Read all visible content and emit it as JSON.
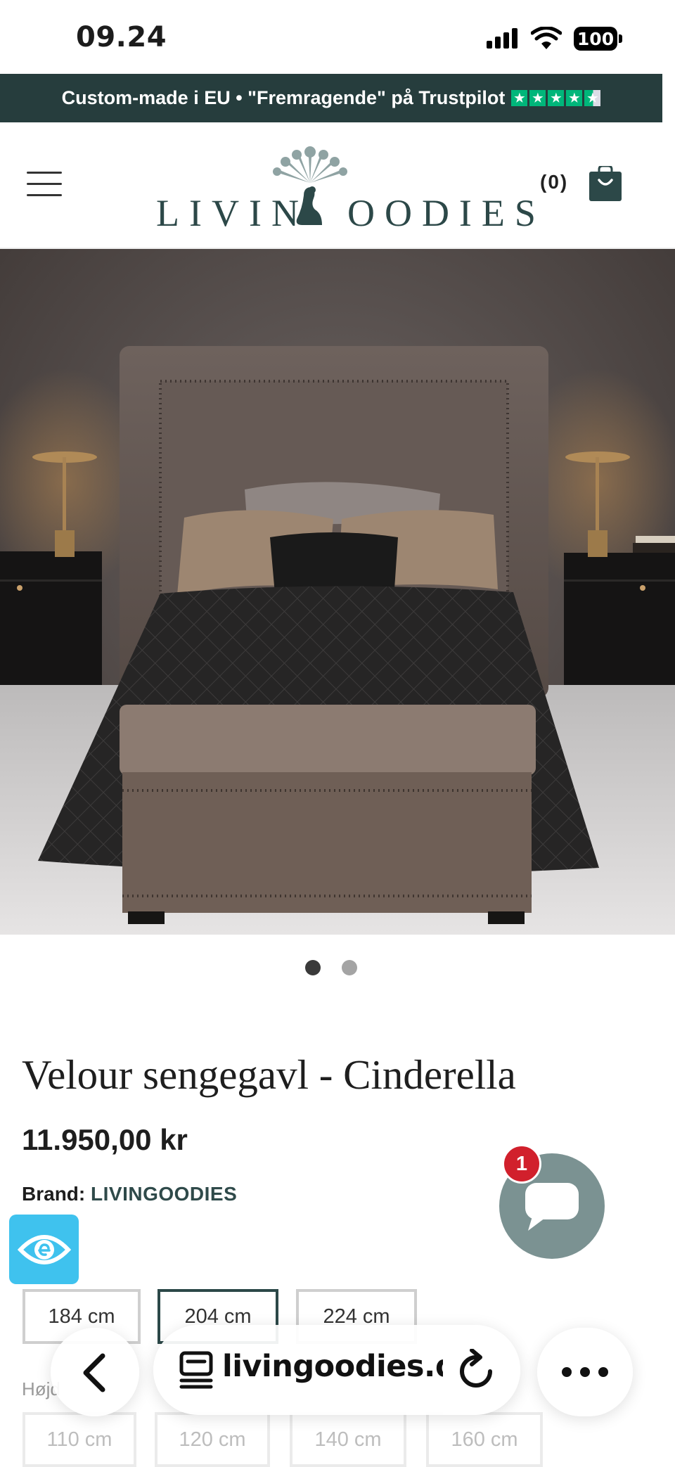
{
  "status_bar": {
    "time": "09.24",
    "battery": "100"
  },
  "announcement": {
    "text": "Custom-made i EU • \"Fremragende\" på Trustpilot",
    "stars": [
      "★",
      "★",
      "★",
      "★",
      "★"
    ]
  },
  "header": {
    "logo_text": "LIVIN  OODIES",
    "cart_count": "(0)"
  },
  "hero": {
    "slide_count": 2,
    "active_slide": 1
  },
  "product": {
    "title": "Velour sengegavl - Cinderella",
    "price": "11.950,00 kr",
    "brand_label": "Brand:",
    "brand_value": "LIVINGOODIES"
  },
  "options": {
    "width_label_partial": "e",
    "widths": [
      "184 cm",
      "204 cm",
      "224 cm"
    ],
    "selected_width": "204 cm",
    "height_label_partial": "Højd",
    "heights": [
      "110 cm",
      "120 cm",
      "140 cm",
      "160 cm"
    ]
  },
  "chat": {
    "badge": "1"
  },
  "browser": {
    "url": "livingoodies.dk"
  },
  "colors": {
    "brand_teal": "#263d3d",
    "trustpilot_green": "#00b67a",
    "chat_grey": "#7b9292",
    "badge_red": "#d1202c",
    "access_blue": "#3fc2ee"
  },
  "icons": [
    "signal-icon",
    "wifi-icon",
    "battery-icon",
    "menu-icon",
    "peacock-logo-icon",
    "shopping-bag-icon",
    "chat-bubble-icon",
    "accessibility-eye-icon",
    "back-chevron-icon",
    "tabs-icon",
    "reload-icon",
    "more-icon"
  ]
}
